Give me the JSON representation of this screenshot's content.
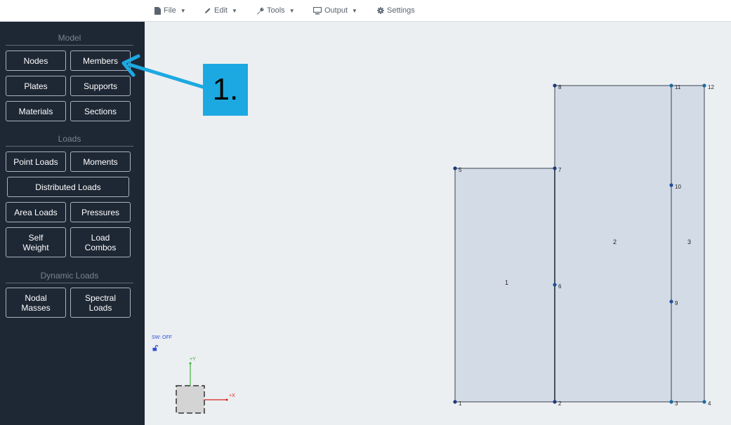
{
  "menu": {
    "file": "File",
    "edit": "Edit",
    "tools": "Tools",
    "output": "Output",
    "settings": "Settings"
  },
  "sidebar": {
    "model_title": "Model",
    "nodes": "Nodes",
    "members": "Members",
    "plates": "Plates",
    "supports": "Supports",
    "materials": "Materials",
    "sections": "Sections",
    "loads_title": "Loads",
    "point_loads": "Point Loads",
    "moments": "Moments",
    "distributed_loads": "Distributed Loads",
    "area_loads": "Area Loads",
    "pressures": "Pressures",
    "self_weight_1": "Self",
    "self_weight_2": "Weight",
    "load_combos_1": "Load",
    "load_combos_2": "Combos",
    "dynamic_title": "Dynamic Loads",
    "nodal_masses_1": "Nodal",
    "nodal_masses_2": "Masses",
    "spectral_loads_1": "Spectral",
    "spectral_loads_2": "Loads"
  },
  "canvas": {
    "sw_status": "SW: OFF",
    "axis_y": "+Y",
    "axis_x": "+X",
    "node_labels": [
      "1",
      "2",
      "3",
      "4",
      "5",
      "6",
      "7",
      "8",
      "9",
      "10",
      "11",
      "12"
    ],
    "plate_labels": [
      "1",
      "2",
      "3"
    ]
  },
  "annotation": {
    "step": "1."
  },
  "colors": {
    "sidebar_bg": "#1e2734",
    "plate_fill": "#d3dce6",
    "node_dark": "#1f3a7a",
    "node_light": "#1f6aa0",
    "callout": "#1ca9e1",
    "axis_x": "#d9231f",
    "axis_y": "#3fae3f"
  }
}
